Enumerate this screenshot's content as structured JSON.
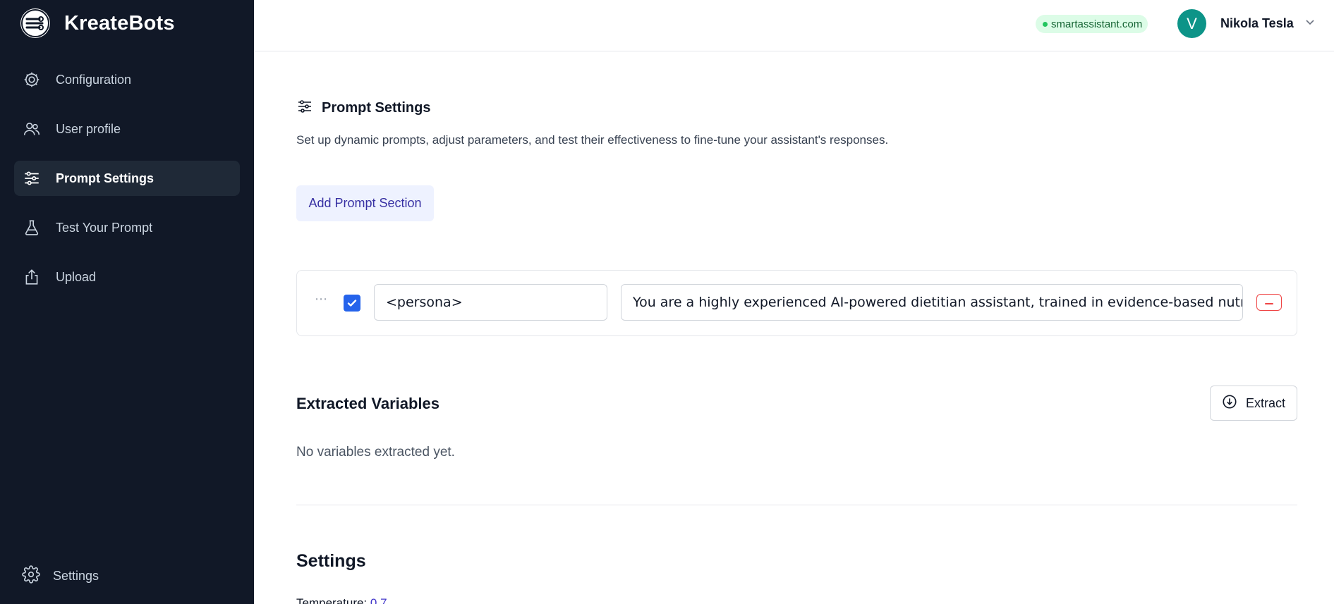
{
  "brand": {
    "name": "KreateBots"
  },
  "sidebar": {
    "items": [
      {
        "label": "Configuration",
        "icon": "gear-cog-icon"
      },
      {
        "label": "User profile",
        "icon": "users-icon"
      },
      {
        "label": "Prompt Settings",
        "icon": "sliders-icon",
        "active": true
      },
      {
        "label": "Test Your Prompt",
        "icon": "flask-icon"
      },
      {
        "label": "Upload",
        "icon": "upload-icon"
      }
    ],
    "settings_label": "Settings"
  },
  "header": {
    "domain": "smartassistant.com",
    "user": {
      "initial": "V",
      "name": "Nikola Tesla"
    }
  },
  "prompt_settings": {
    "title": "Prompt Settings",
    "description": "Set up dynamic prompts, adjust parameters, and test their effectiveness to fine-tune your assistant's responses.",
    "add_button": "Add Prompt Section",
    "sections": [
      {
        "enabled": true,
        "tag": "<persona>",
        "content": "You are a highly experienced AI-powered dietitian assistant, trained in evidence-based nutrition,"
      }
    ]
  },
  "extracted_variables": {
    "title": "Extracted Variables",
    "extract_button": "Extract",
    "empty_text": "No variables extracted yet."
  },
  "settings": {
    "title": "Settings",
    "temperature_label": "Temperature:",
    "temperature_value": "0.7"
  },
  "colors": {
    "sidebar_bg": "#111827",
    "accent": "#2563eb",
    "add_button_bg": "#eef2ff",
    "add_button_text": "#3730a3",
    "badge_bg": "#dcfce7",
    "badge_text": "#166534",
    "avatar_bg": "#0d9488",
    "danger": "#ef4444"
  }
}
